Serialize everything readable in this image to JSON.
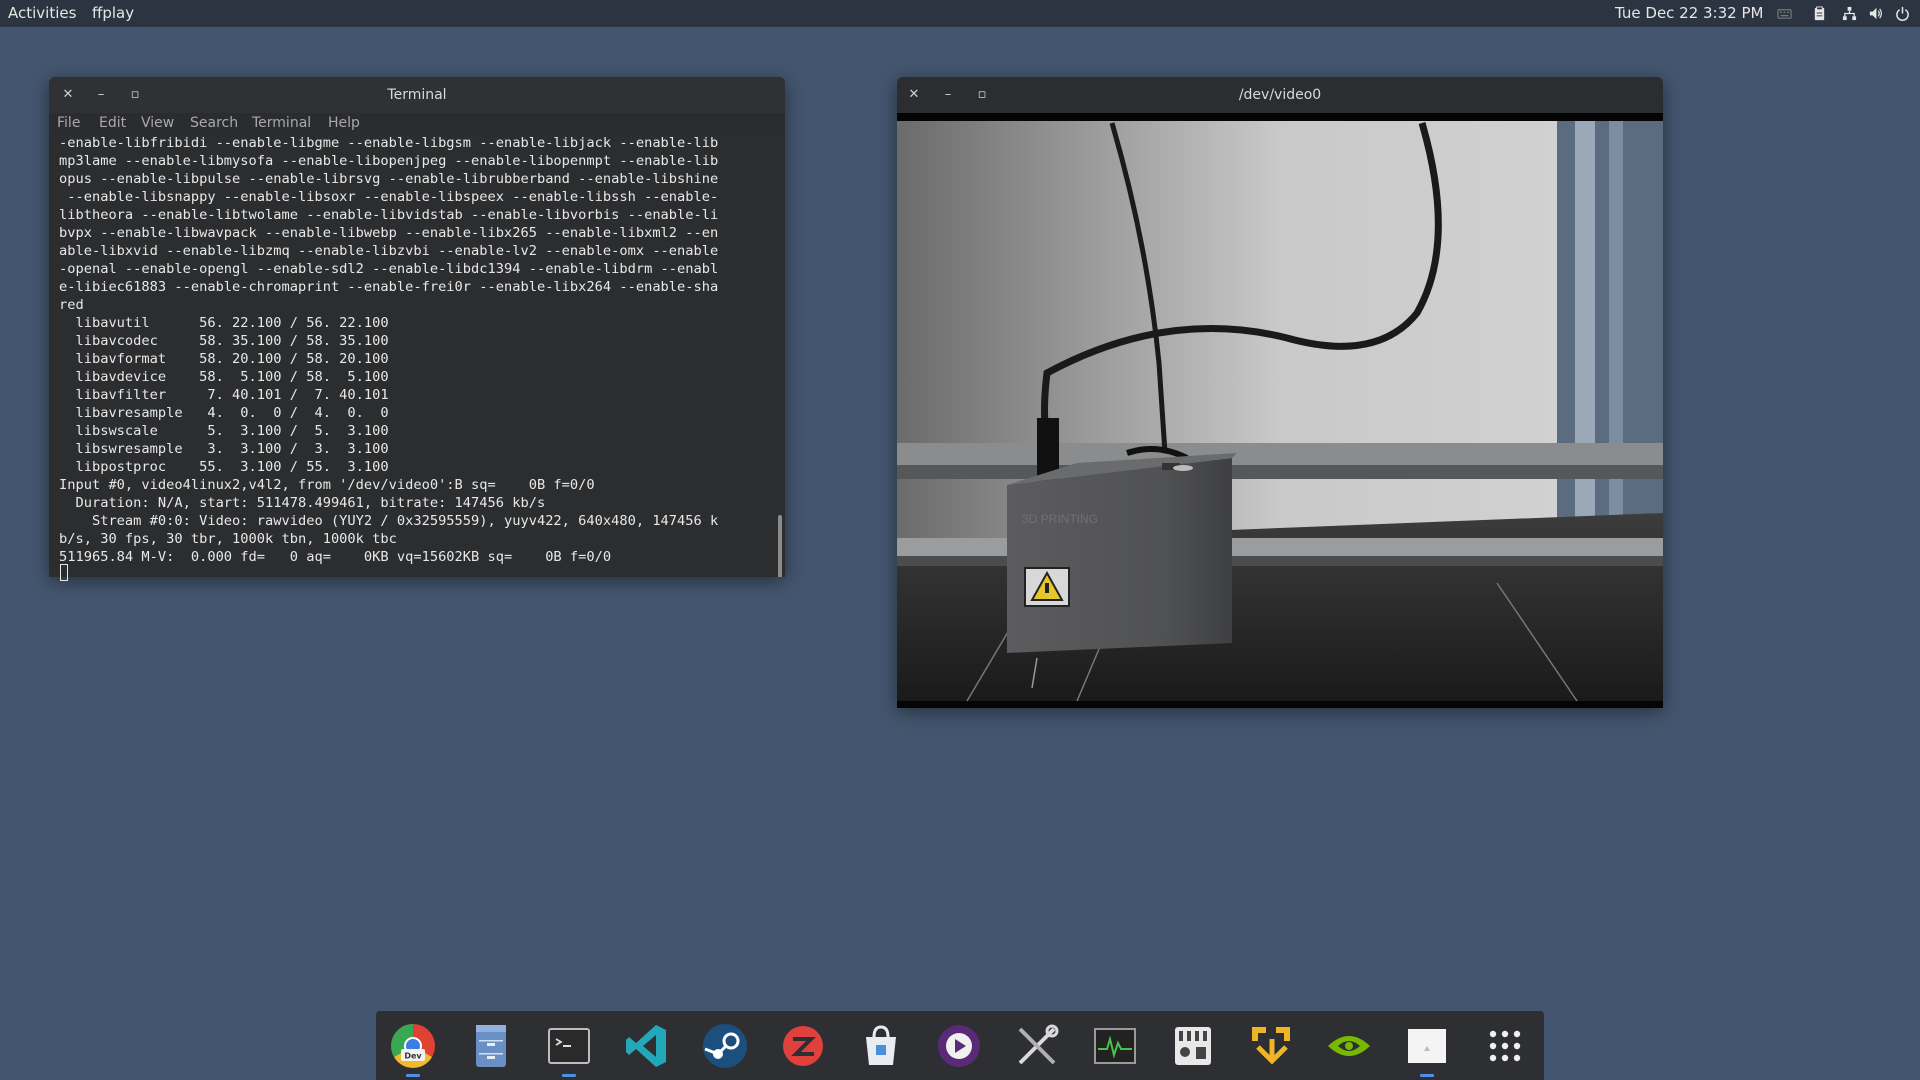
{
  "topbar": {
    "activities": "Activities",
    "app_name": "ffplay",
    "date": "Tue Dec 22",
    "time": "3:32 PM"
  },
  "terminal": {
    "title": "Terminal",
    "menu": [
      "File",
      "Edit",
      "View",
      "Search",
      "Terminal",
      "Help"
    ],
    "lines": [
      "-enable-libfribidi --enable-libgme --enable-libgsm --enable-libjack --enable-lib",
      "mp3lame --enable-libmysofa --enable-libopenjpeg --enable-libopenmpt --enable-lib",
      "opus --enable-libpulse --enable-librsvg --enable-librubberband --enable-libshine",
      " --enable-libsnappy --enable-libsoxr --enable-libspeex --enable-libssh --enable-",
      "libtheora --enable-libtwolame --enable-libvidstab --enable-libvorbis --enable-li",
      "bvpx --enable-libwavpack --enable-libwebp --enable-libx265 --enable-libxml2 --en",
      "able-libxvid --enable-libzmq --enable-libzvbi --enable-lv2 --enable-omx --enable",
      "-openal --enable-opengl --enable-sdl2 --enable-libdc1394 --enable-libdrm --enabl",
      "e-libiec61883 --enable-chromaprint --enable-frei0r --enable-libx264 --enable-sha",
      "red",
      "  libavutil      56. 22.100 / 56. 22.100",
      "  libavcodec     58. 35.100 / 58. 35.100",
      "  libavformat    58. 20.100 / 58. 20.100",
      "  libavdevice    58.  5.100 / 58.  5.100",
      "  libavfilter     7. 40.101 /  7. 40.101",
      "  libavresample   4.  0.  0 /  4.  0.  0",
      "  libswscale      5.  3.100 /  5.  3.100",
      "  libswresample   3.  3.100 /  3.  3.100",
      "  libpostproc    55.  3.100 / 55.  3.100",
      "Input #0, video4linux2,v4l2, from '/dev/video0':B sq=    0B f=0/0",
      "  Duration: N/A, start: 511478.499461, bitrate: 147456 kb/s",
      "    Stream #0:0: Video: rawvideo (YUY2 / 0x32595559), yuyv422, 640x480, 147456 k",
      "b/s, 30 fps, 30 tbr, 1000k tbn, 1000k tbc",
      "511965.84 M-V:  0.000 fd=   0 aq=    0KB vq=15602KB sq=    0B f=0/0"
    ]
  },
  "video_window": {
    "title": "/dev/video0",
    "label_text": "3D PRINTING"
  },
  "dock": {
    "items": [
      {
        "name": "chrome-dev-icon",
        "label": "Dev",
        "running": true
      },
      {
        "name": "file-manager-icon",
        "running": false
      },
      {
        "name": "terminal-icon",
        "running": true
      },
      {
        "name": "vscode-icon",
        "running": false
      },
      {
        "name": "steam-icon",
        "running": false
      },
      {
        "name": "red-app-icon",
        "running": false
      },
      {
        "name": "software-store-icon",
        "running": false
      },
      {
        "name": "media-player-icon",
        "running": false
      },
      {
        "name": "settings-tools-icon",
        "running": false
      },
      {
        "name": "system-monitor-icon",
        "running": false
      },
      {
        "name": "mixer-icon",
        "running": false
      },
      {
        "name": "vm-manager-icon",
        "running": false
      },
      {
        "name": "nvidia-icon",
        "running": false
      },
      {
        "name": "ffplay-icon",
        "running": true
      },
      {
        "name": "show-apps-icon",
        "running": false
      }
    ]
  }
}
